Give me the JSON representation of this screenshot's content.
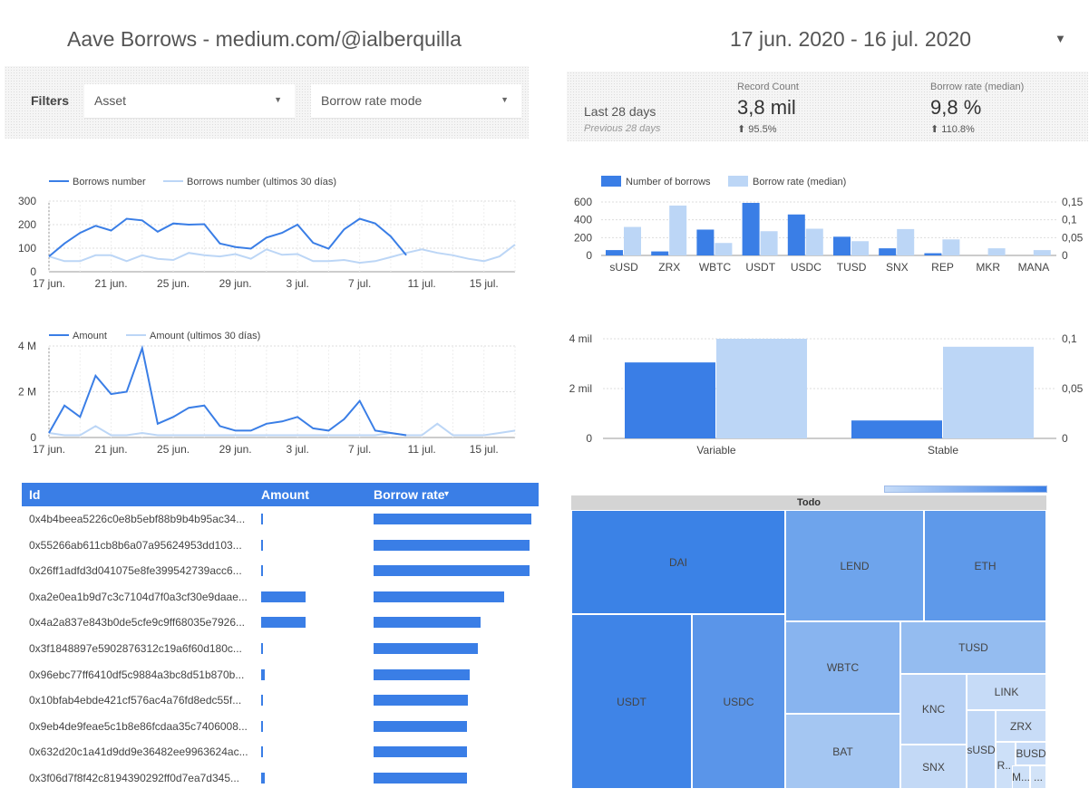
{
  "header": {
    "title": "Aave Borrows - medium.com/@ialberquilla",
    "date_range": "17 jun. 2020 - 16 jul. 2020"
  },
  "filters": {
    "label": "Filters",
    "asset_label": "Asset",
    "mode_label": "Borrow rate mode"
  },
  "scorecard": {
    "period": "Last 28 days",
    "previous": "Previous 28 days",
    "metrics": [
      {
        "label": "Record Count",
        "value": "3,8 mil",
        "delta": "95.5%"
      },
      {
        "label": "Borrow rate (median)",
        "value": "9,8 %",
        "delta": "110.8%"
      }
    ]
  },
  "chart_data": [
    {
      "type": "line",
      "series": [
        {
          "name": "Borrows number",
          "values": [
            65,
            120,
            165,
            195,
            175,
            225,
            218,
            170,
            205,
            200,
            202,
            120,
            105,
            98,
            145,
            165,
            200,
            123,
            98,
            180,
            225,
            205,
            150,
            70
          ]
        },
        {
          "name": "Borrows number (ultimos 30 días)",
          "values": [
            65,
            45,
            45,
            70,
            70,
            45,
            70,
            55,
            50,
            80,
            70,
            65,
            75,
            55,
            95,
            72,
            75,
            45,
            45,
            50,
            38,
            45,
            62,
            80,
            95,
            80,
            70,
            55,
            45,
            65,
            115
          ]
        }
      ],
      "x_ticks": [
        "17 jun.",
        "21 jun.",
        "25 jun.",
        "29 jun.",
        "3 jul.",
        "7 jul.",
        "11 jul.",
        "15 jul."
      ],
      "y_ticks": [
        "0",
        "100",
        "200",
        "300"
      ],
      "ylim": [
        0,
        300
      ]
    },
    {
      "type": "line",
      "series": [
        {
          "name": "Amount",
          "values": [
            0.2,
            1.4,
            0.9,
            2.7,
            1.9,
            2.0,
            3.9,
            0.6,
            0.9,
            1.3,
            1.4,
            0.5,
            0.3,
            0.3,
            0.6,
            0.7,
            0.9,
            0.4,
            0.3,
            0.8,
            1.6,
            0.3,
            0.2,
            0.1
          ]
        },
        {
          "name": "Amount (ultimos 30 días)",
          "values": [
            0.2,
            0.1,
            0.1,
            0.5,
            0.1,
            0.1,
            0.2,
            0.1,
            0.1,
            0.1,
            0.1,
            0.1,
            0.1,
            0.1,
            0.1,
            0.1,
            0.1,
            0.1,
            0.1,
            0.1,
            0.1,
            0.1,
            0.2,
            0.1,
            0.1,
            0.6,
            0.1,
            0.1,
            0.1,
            0.2,
            0.3
          ]
        }
      ],
      "x_ticks": [
        "17 jun.",
        "21 jun.",
        "25 jun.",
        "29 jun.",
        "3 jul.",
        "7 jul.",
        "11 jul.",
        "15 jul."
      ],
      "y_ticks": [
        "0",
        "2 M",
        "4 M"
      ],
      "ylim": [
        0,
        4
      ]
    },
    {
      "type": "bar",
      "categories": [
        "sUSD",
        "ZRX",
        "WBTC",
        "USDT",
        "USDC",
        "TUSD",
        "SNX",
        "REP",
        "MKR",
        "MANA"
      ],
      "series": [
        {
          "name": "Number of borrows",
          "values": [
            60,
            45,
            290,
            590,
            460,
            210,
            80,
            25,
            0,
            0
          ]
        },
        {
          "name": "Borrow rate (median)",
          "values": [
            0.08,
            0.14,
            0.035,
            0.068,
            0.075,
            0.04,
            0.074,
            0.045,
            0.02,
            0.015
          ]
        }
      ],
      "y_ticks": [
        "0",
        "200",
        "400",
        "600"
      ],
      "y2_ticks": [
        "0",
        "0,05",
        "0,1",
        "0,15"
      ]
    },
    {
      "type": "bar",
      "categories": [
        "Variable",
        "Stable"
      ],
      "series": [
        {
          "name": "Record Count",
          "values": [
            3050,
            720
          ]
        },
        {
          "name": "Borrow rate (median)",
          "values": [
            0.1,
            0.092
          ]
        }
      ],
      "y_ticks": [
        "0",
        "2 mil",
        "4 mil"
      ],
      "y2_ticks": [
        "0",
        "0,05",
        "0,1"
      ]
    }
  ],
  "table": {
    "headers": {
      "id": "Id",
      "amount": "Amount",
      "rate": "Borrow rate",
      "sort": "▾"
    },
    "rows": [
      {
        "id": "0x4b4beea5226c0e8b5ebf88b9b4b95ac34...",
        "amount": 0.01,
        "rate": 1.0
      },
      {
        "id": "0x55266ab611cb8b6a07a95624953dd103...",
        "amount": 0.01,
        "rate": 0.99
      },
      {
        "id": "0x26ff1adfd3d041075e8fe399542739acc6...",
        "amount": 0.01,
        "rate": 0.99
      },
      {
        "id": "0xa2e0ea1b9d7c3c7104d7f0a3cf30e9daae...",
        "amount": 0.27,
        "rate": 0.83
      },
      {
        "id": "0x4a2a837e843b0de5cfe9c9ff68035e7926...",
        "amount": 0.27,
        "rate": 0.68
      },
      {
        "id": "0x3f1848897e5902876312c19a6f60d180c...",
        "amount": 0.01,
        "rate": 0.66
      },
      {
        "id": "0x96ebc77ff6410df5c9884a3bc8d51b870b...",
        "amount": 0.02,
        "rate": 0.61
      },
      {
        "id": "0x10bfab4ebde421cf576ac4a76fd8edc55f...",
        "amount": 0.01,
        "rate": 0.6
      },
      {
        "id": "0x9eb4de9feae5c1b8e86fcdaa35c7406008...",
        "amount": 0.01,
        "rate": 0.59
      },
      {
        "id": "0x632d20c1a41d9dd9e36482ee9963624ac...",
        "amount": 0.01,
        "rate": 0.59
      },
      {
        "id": "0x3f06d7f8f42c8194390292ff0d7ea7d345...",
        "amount": 0.02,
        "rate": 0.59
      }
    ]
  },
  "treemap": {
    "header": "Todo",
    "cells": [
      "DAI",
      "LEND",
      "ETH",
      "USDT",
      "USDC",
      "WBTC",
      "TUSD",
      "BAT",
      "KNC",
      "LINK",
      "sUSD",
      "ZRX",
      "BUSD",
      "SNX",
      "R...",
      "M...",
      "..."
    ]
  },
  "colors": {
    "primary": "#3a7ee6",
    "secondary": "#bcd6f6"
  }
}
